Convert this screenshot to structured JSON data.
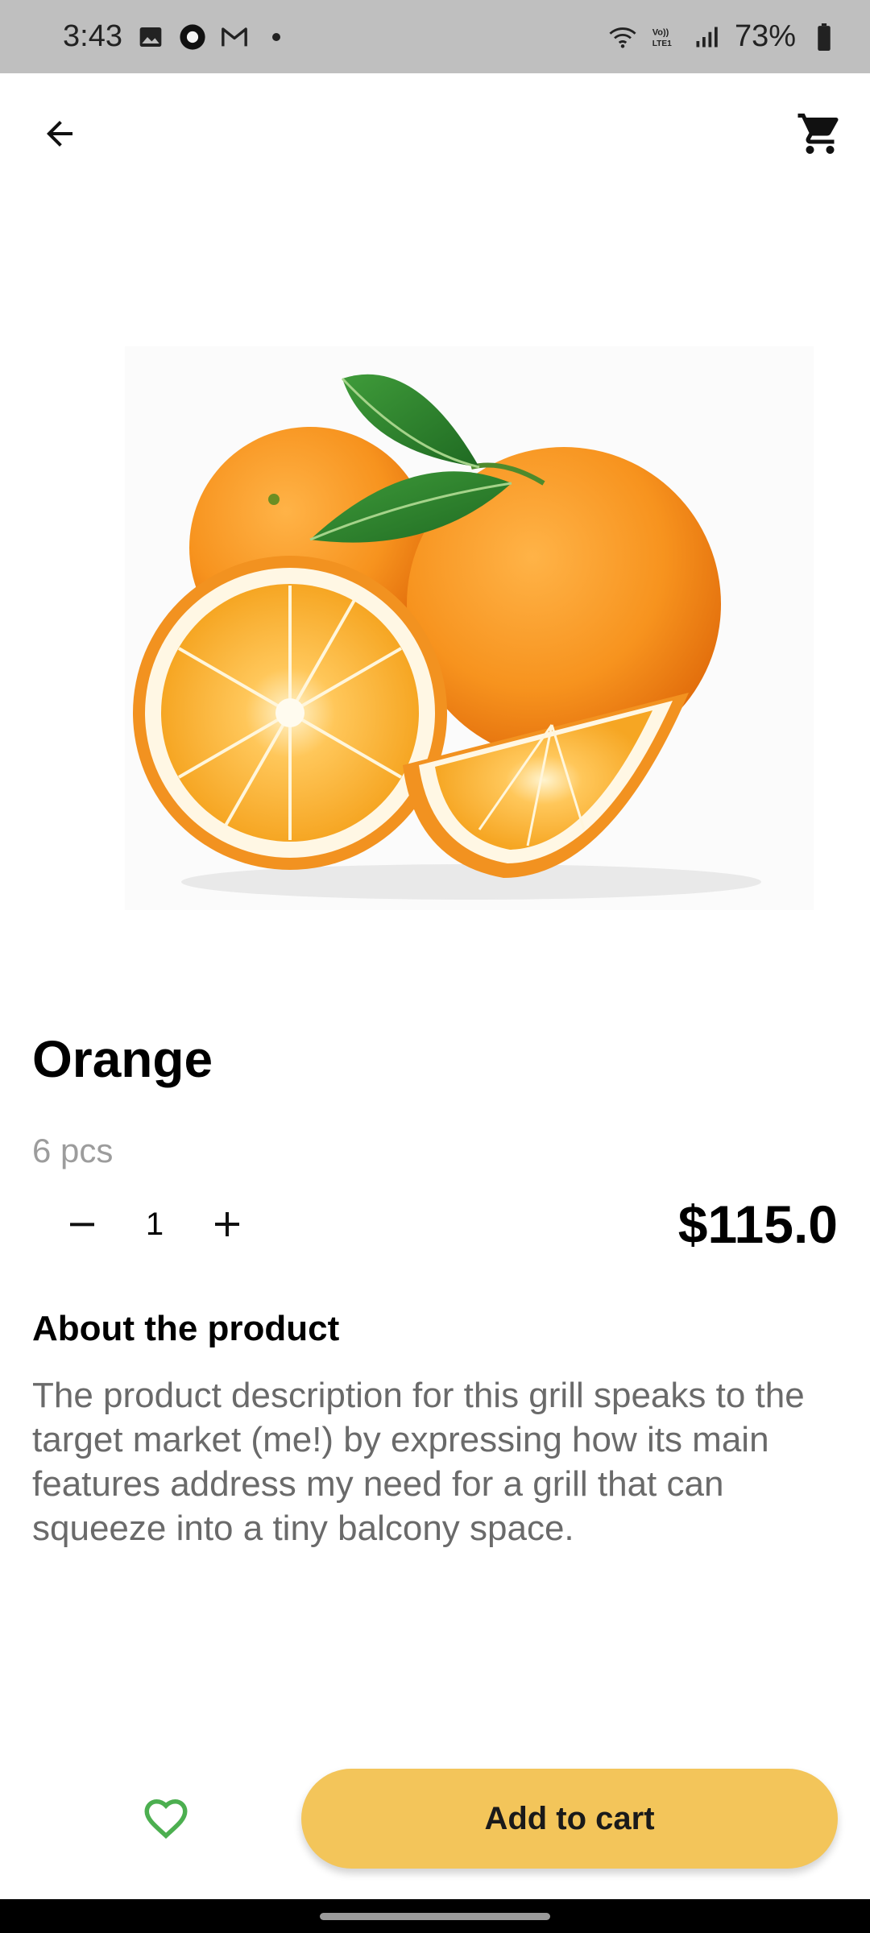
{
  "status_bar": {
    "time": "3:43",
    "battery": "73%",
    "left_icons": [
      "gallery-icon",
      "app-notification-icon",
      "gmail-icon",
      "dot-icon"
    ],
    "right_icons": [
      "wifi-icon",
      "volte-icon",
      "signal-icon",
      "battery-icon"
    ]
  },
  "top_bar": {
    "back_icon": "arrow-left-icon",
    "cart_icon": "shopping-cart-icon"
  },
  "product": {
    "image": "orange-image",
    "name": "Orange",
    "unit": "6 pcs",
    "quantity": "1",
    "price": "$115.0",
    "about_title": "About the product",
    "description": "The product description for this grill speaks to the target market (me!) by expressing how its main features address my need for a grill that can squeeze into a tiny balcony space."
  },
  "actions": {
    "favorite_icon": "heart-outline-icon",
    "add_to_cart_label": "Add to cart"
  },
  "colors": {
    "accent": "#f3c55a",
    "favorite": "#4caf50",
    "status_bar_bg": "#bfbfbf",
    "muted_text": "#9c9c9c"
  }
}
